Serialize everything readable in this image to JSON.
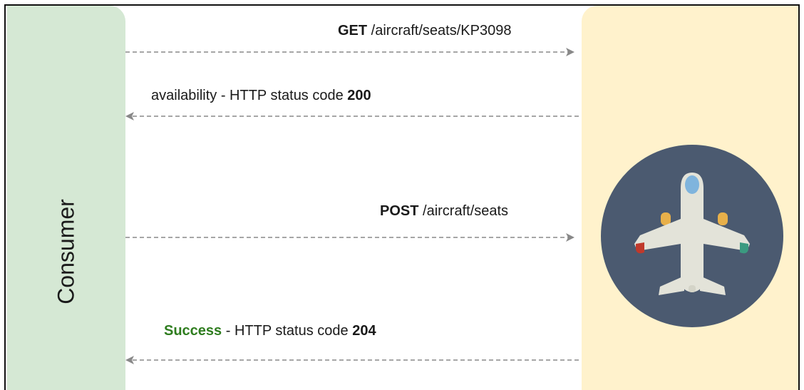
{
  "diagram": {
    "consumer_label": "Consumer",
    "messages": [
      {
        "method": "GET",
        "text": " /aircraft/seats/KP3098",
        "direction": "right"
      },
      {
        "prefix": "availability - HTTP status code ",
        "code": "200",
        "direction": "left"
      },
      {
        "method": "POST",
        "text": " /aircraft/seats",
        "direction": "right"
      },
      {
        "status": "Success",
        "middle": " - HTTP status code ",
        "code": "204",
        "direction": "left"
      }
    ],
    "icons": {
      "service": "airplane-icon"
    },
    "colors": {
      "consumer_panel": "#d5e8d4",
      "service_panel": "#fff2cc",
      "arrow": "#888888",
      "success": "#2f7d1f",
      "plane_circle": "#4b5a70"
    }
  }
}
